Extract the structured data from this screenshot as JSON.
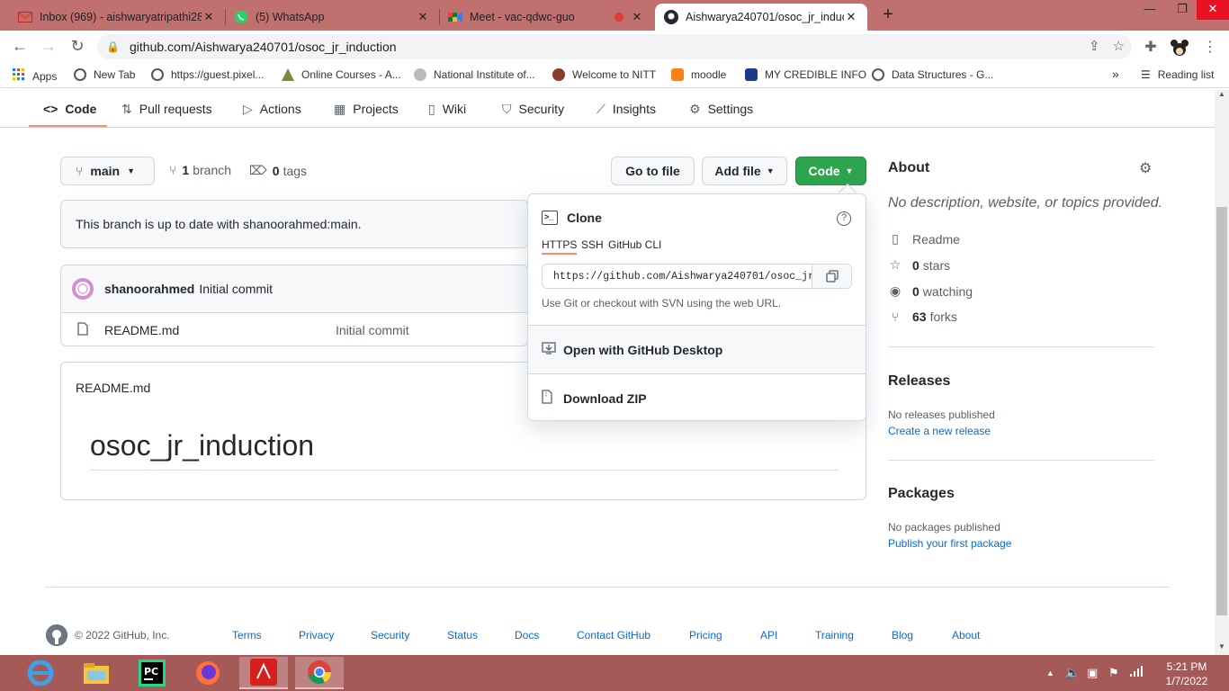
{
  "browser": {
    "tabs": [
      {
        "title": "Inbox (969) - aishwaryatripathi28",
        "icon": "gmail-icon"
      },
      {
        "title": "(5) WhatsApp",
        "icon": "whatsapp-icon"
      },
      {
        "title": "Meet - vac-qdwc-guo",
        "icon": "meet-icon"
      },
      {
        "title": "Aishwarya240701/osoc_jr_induct",
        "icon": "github-icon"
      }
    ],
    "url": "github.com/Aishwarya240701/osoc_jr_induction",
    "bookmarks": [
      "Apps",
      "New Tab",
      "https://guest.pixel...",
      "Online Courses - A...",
      "National Institute of...",
      "Welcome to NITT",
      "moodle",
      "MY CREDIBLE INFO",
      "Data Structures - G..."
    ],
    "reading_list": "Reading list",
    "more_bookmarks": "»"
  },
  "repo_nav": {
    "tabs": [
      "Code",
      "Pull requests",
      "Actions",
      "Projects",
      "Wiki",
      "Security",
      "Insights",
      "Settings"
    ]
  },
  "branch": {
    "name": "main",
    "branch_count": "1",
    "branch_label": "branch",
    "tag_count": "0",
    "tag_label": "tags",
    "go_to_file": "Go to file",
    "add_file": "Add file",
    "code": "Code"
  },
  "status": "This branch is up to date with shanoorahmed:main.",
  "commit": {
    "author": "shanoorahmed",
    "message": "Initial commit"
  },
  "files": [
    {
      "name": "README.md",
      "message": "Initial commit"
    }
  ],
  "readme": {
    "title": "README.md",
    "heading": "osoc_jr_induction"
  },
  "clone": {
    "title": "Clone",
    "protocols": [
      "HTTPS",
      "SSH",
      "GitHub CLI"
    ],
    "url": "https://github.com/Aishwarya240701/osoc_jr",
    "hint": "Use Git or checkout with SVN using the web URL.",
    "open_desktop": "Open with GitHub Desktop",
    "download_zip": "Download ZIP"
  },
  "about": {
    "heading": "About",
    "description": "No description, website, or topics provided.",
    "readme": "Readme",
    "stars_count": "0",
    "stars_label": "stars",
    "watching_count": "0",
    "watching_label": "watching",
    "forks_count": "63",
    "forks_label": "forks"
  },
  "releases": {
    "heading": "Releases",
    "text": "No releases published",
    "link": "Create a new release"
  },
  "packages": {
    "heading": "Packages",
    "text": "No packages published",
    "link": "Publish your first package"
  },
  "footer": {
    "copyright": "© 2022 GitHub, Inc.",
    "links": [
      "Terms",
      "Privacy",
      "Security",
      "Status",
      "Docs",
      "Contact GitHub",
      "Pricing",
      "API",
      "Training",
      "Blog",
      "About"
    ]
  },
  "taskbar": {
    "time": "5:21 PM",
    "date": "1/7/2022"
  },
  "colors": {
    "accent_green": "#2da44e",
    "link_blue": "#0969da",
    "tab_underline": "#fd8c73",
    "chrome_frame": "#c0706e"
  }
}
